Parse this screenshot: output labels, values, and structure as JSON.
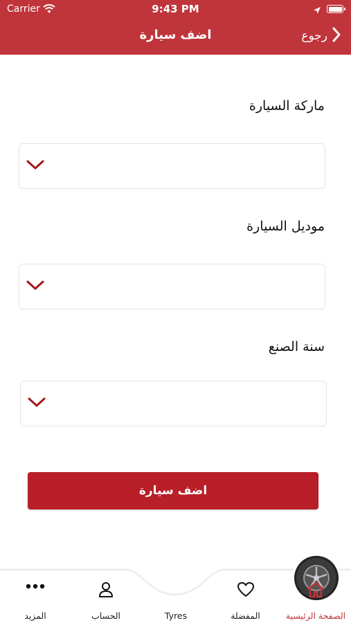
{
  "status_bar": {
    "carrier": "Carrier",
    "time": "9:43 PM"
  },
  "header": {
    "title": "اضف سيارة",
    "back_label": "رجوع"
  },
  "form": {
    "fields": [
      {
        "label": "ماركة السيارة",
        "value": ""
      },
      {
        "label": "موديل السيارة",
        "value": ""
      },
      {
        "label": "سنة الصنع",
        "value": ""
      }
    ],
    "submit_label": "اضف سيارة"
  },
  "tabbar": {
    "items": [
      {
        "label": "المزيد",
        "icon": "more-icon"
      },
      {
        "label": "الحساب",
        "icon": "user-icon"
      },
      {
        "label": "Tyres",
        "icon": "tyre-icon"
      },
      {
        "label": "المفضلة",
        "icon": "heart-icon"
      },
      {
        "label": "الصفحة الرئيسية",
        "icon": "home-icon"
      }
    ],
    "active_index": 4
  },
  "colors": {
    "brand": "#c0353b",
    "button": "#b81f28",
    "chevron": "#a3161c"
  }
}
